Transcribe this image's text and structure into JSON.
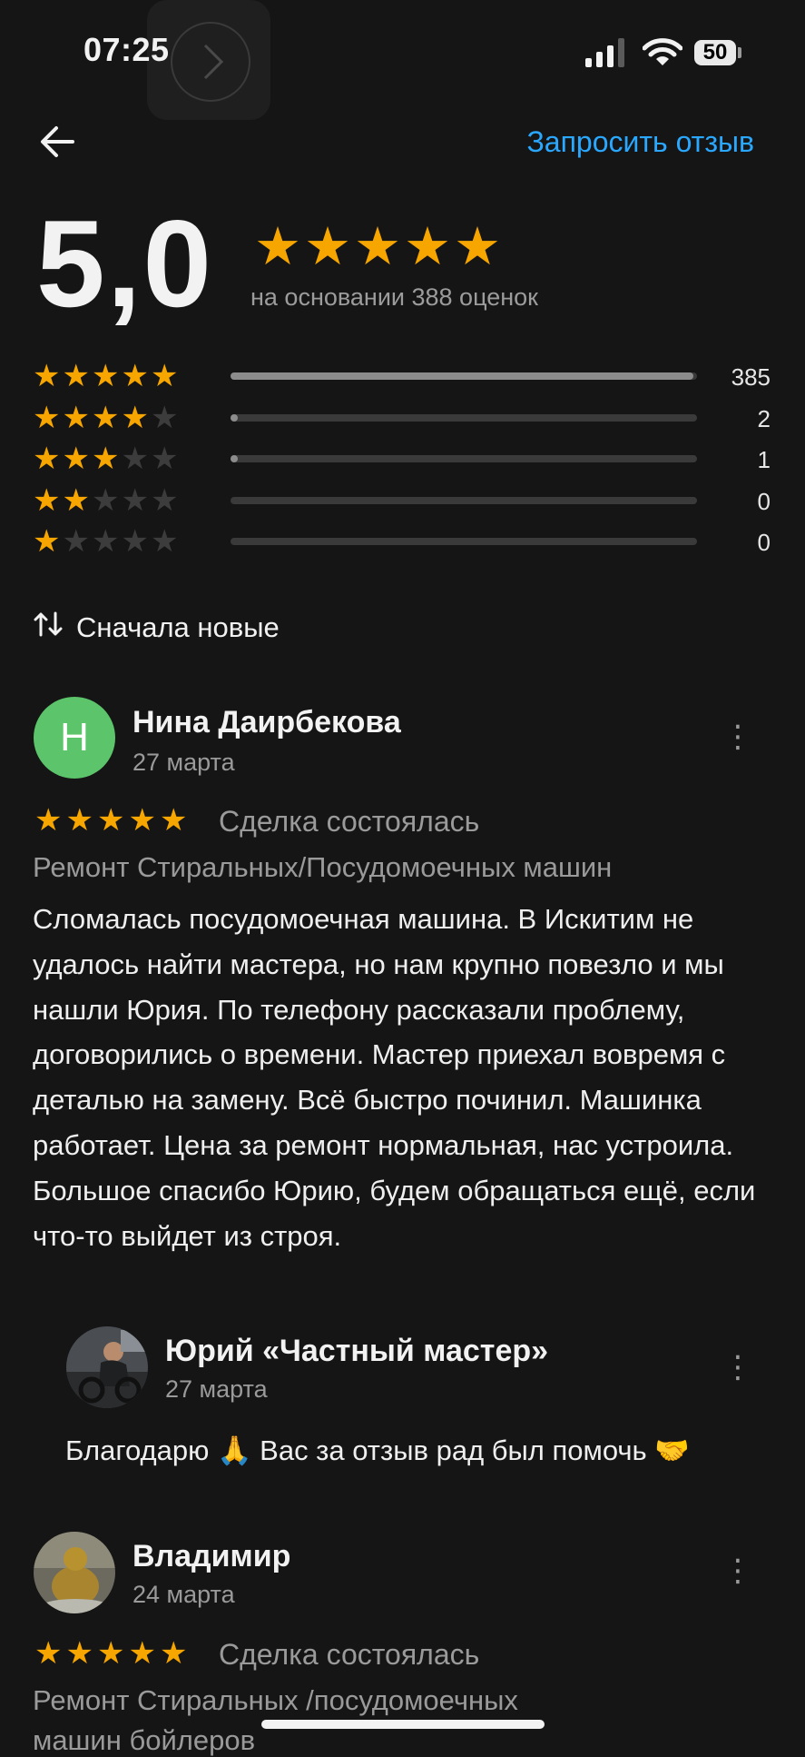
{
  "status_bar": {
    "time": "07:25",
    "battery": "50"
  },
  "header": {
    "back_icon": "arrow-left-icon",
    "request_review": "Запросить отзыв"
  },
  "rating": {
    "value": "5,0",
    "stars": 5,
    "caption": "на основании 388 оценок",
    "distribution": [
      {
        "stars": 5,
        "count": "385",
        "fraction": 0.992
      },
      {
        "stars": 4,
        "count": "2",
        "fraction": 0.005
      },
      {
        "stars": 3,
        "count": "1",
        "fraction": 0.003
      },
      {
        "stars": 2,
        "count": "0",
        "fraction": 0
      },
      {
        "stars": 1,
        "count": "0",
        "fraction": 0
      }
    ]
  },
  "sort": {
    "icon": "sort-arrows-icon",
    "label": "Сначала новые"
  },
  "reviews": [
    {
      "avatar_letter": "Н",
      "author": "Нина Даирбекова",
      "date": "27 марта",
      "stars": 5,
      "deal": "Сделка состоялась",
      "service": "Ремонт Стиральных/Посудомоечных машин",
      "text": "Сломалась посудомоечная машина. В Искитим не удалось найти мастера, но нам крупно повезло и  мы нашли Юрия. По телефону рассказали проблему, договорились о времени. Мастер приехал вовремя с деталью  на замену. Всё быстро починил. Машинка работает.  Цена за ремонт нормальная, нас устроила. Большое спасибо Юрию, будем обращаться ещё, если что-то выйдет из строя.",
      "reply": {
        "author": "Юрий  «Частный мастер»",
        "date": "27 марта",
        "text": "Благодарю 🙏 Вас за отзыв рад был помочь 🤝"
      }
    },
    {
      "author": "Владимир",
      "date": "24 марта",
      "stars": 5,
      "deal": "Сделка состоялась",
      "service": "Ремонт Стиральных /посудомоечных",
      "service_line2": "машин бойлеров"
    }
  ],
  "colors": {
    "accent": "#2aa8ff",
    "star": "#f7a600",
    "avatar_green": "#5cc46a",
    "background": "#151515"
  }
}
